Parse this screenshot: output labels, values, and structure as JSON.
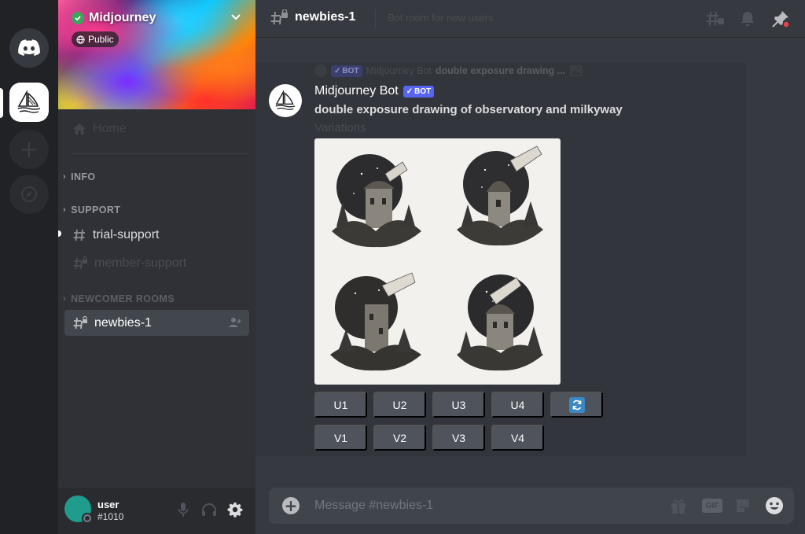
{
  "server": {
    "name": "Midjourney",
    "visibility": "Public"
  },
  "sidebar": {
    "home_label": "Home",
    "categories": [
      {
        "label": "INFO"
      },
      {
        "label": "SUPPORT"
      },
      {
        "label": "NEWCOMER ROOMS"
      }
    ],
    "channels": [
      {
        "label": "trial-support"
      },
      {
        "label": "member-support"
      },
      {
        "label": "newbies-1"
      }
    ]
  },
  "user": {
    "name": "user",
    "tag": "#1010"
  },
  "header": {
    "channel": "newbies-1",
    "topic": "Bot room for new users."
  },
  "message": {
    "reply": {
      "bot_tag": "BOT",
      "author": "Midjourney Bot",
      "text": "double exposure drawing ..."
    },
    "author": "Midjourney Bot",
    "bot_tag": "BOT",
    "prompt": "double exposure drawing of observatory and milkyway",
    "subtitle": "Variations",
    "upscale_buttons": [
      "U1",
      "U2",
      "U3",
      "U4"
    ],
    "variation_buttons": [
      "V1",
      "V2",
      "V3",
      "V4"
    ]
  },
  "composer": {
    "placeholder": "Message #newbies-1",
    "gif_label": "GIF"
  },
  "colors": {
    "blurple": "#5865f2",
    "online_green": "#3ba55c",
    "reroll_blue": "#3b88c3",
    "avatar_teal": "#1f9c8c",
    "notification_red": "#ed4245"
  },
  "icons": [
    "discord-logo-icon",
    "midjourney-sailboat-icon",
    "add-server-icon",
    "explore-compass-icon",
    "verified-check-icon",
    "chevron-down-icon",
    "globe-icon",
    "home-icon",
    "hash-icon",
    "locked-hash-icon",
    "add-member-icon",
    "microphone-icon",
    "headphones-icon",
    "gear-icon",
    "threads-icon",
    "bell-icon",
    "pin-icon",
    "image-icon",
    "reroll-icon",
    "plus-icon",
    "gift-icon",
    "sticker-icon",
    "emoji-icon"
  ]
}
